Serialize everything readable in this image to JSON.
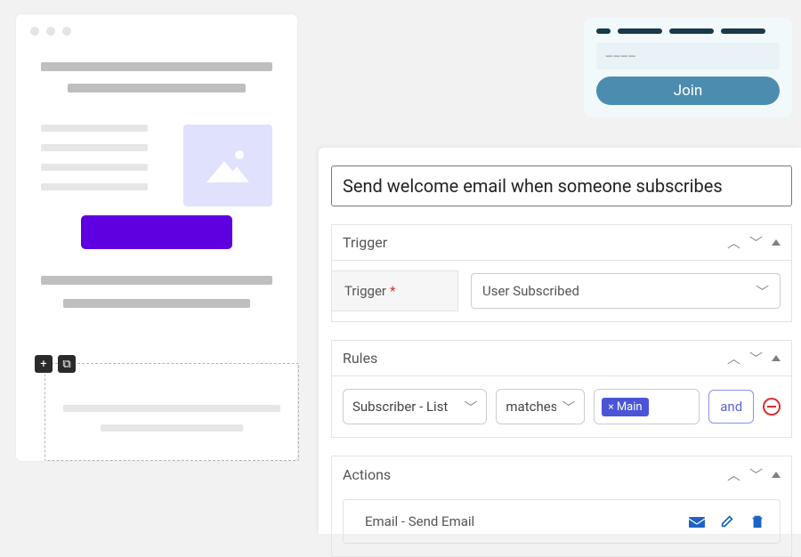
{
  "join": {
    "placeholder": "————",
    "button_label": "Join"
  },
  "automation": {
    "name": "Send welcome email when someone subscribes",
    "sections": {
      "trigger": {
        "title": "Trigger",
        "field_label": "Trigger",
        "selected": "User Subscribed"
      },
      "rules": {
        "title": "Rules",
        "condition_field": "Subscriber - List",
        "condition_op": "matches a",
        "tag_label": "Main",
        "logic_label": "and"
      },
      "actions": {
        "title": "Actions",
        "items": [
          {
            "label": "Email - Send Email"
          }
        ]
      }
    }
  },
  "icons": {
    "plus": "+",
    "duplicate": "⧉",
    "chevron_up": "︿",
    "chevron_down": "﹀",
    "small_chevron_down": "﹀",
    "tag_close": "×"
  }
}
